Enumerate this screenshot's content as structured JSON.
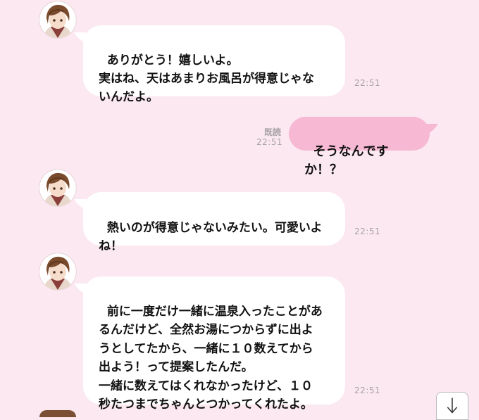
{
  "messages": [
    {
      "direction": "in",
      "text": "ありがとう！嬉しいよ。\n実はね、天はあまりお風呂が得意じゃな\nいんだよ。",
      "time": "22:51",
      "avatar_icon": "character-avatar-icon"
    },
    {
      "direction": "out",
      "text": "そうなんですか！？",
      "time": "22:51",
      "read_label": "既読"
    },
    {
      "direction": "in",
      "text": "熱いのが得意じゃないみたい。可愛いよ\nね！",
      "time": "22:51",
      "avatar_icon": "character-avatar-icon"
    },
    {
      "direction": "in",
      "text": "前に一度だけ一緒に温泉入ったことがあ\nるんだけど、全然お湯につからずに出よ\nうとしてたから、一緒に１０数えてから\n出よう！って提案したんだ。\n一緒に数えてはくれなかったけど、１０\n秒たつまでちゃんとつかってくれたよ。",
      "time": "22:51",
      "avatar_icon": "character-avatar-icon"
    }
  ],
  "scroll_button": {
    "icon": "scroll-down-arrow-icon"
  },
  "colors": {
    "background": "#fbe8f0",
    "incoming_bubble": "#ffffff",
    "outgoing_bubble": "#f6b8d2",
    "timestamp": "#a8a2a6"
  }
}
